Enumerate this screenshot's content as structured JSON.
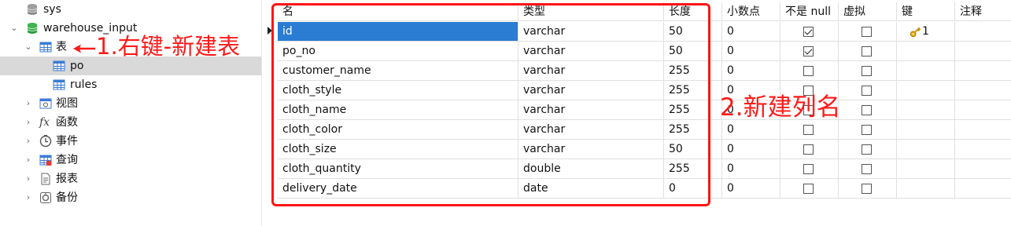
{
  "tree": {
    "items": [
      {
        "label": "sys",
        "icon": "database-icon"
      },
      {
        "label": "warehouse_input",
        "icon": "database-icon"
      },
      {
        "label": "表",
        "icon": "table-folder-icon"
      },
      {
        "label": "po",
        "icon": "table-icon"
      },
      {
        "label": "rules",
        "icon": "table-icon"
      },
      {
        "label": "视图",
        "icon": "view-icon"
      },
      {
        "label": "函数",
        "icon": "function-icon"
      },
      {
        "label": "事件",
        "icon": "event-icon"
      },
      {
        "label": "查询",
        "icon": "query-icon"
      },
      {
        "label": "报表",
        "icon": "report-icon"
      },
      {
        "label": "备份",
        "icon": "backup-icon"
      }
    ],
    "fx_glyph": "fx"
  },
  "annotations": {
    "step1": "1.右键-新建表",
    "step2": "2.新建列名",
    "color": "#ff1a1a"
  },
  "grid": {
    "headers": [
      "名",
      "类型",
      "长度",
      "小数点",
      "不是 null",
      "虚拟",
      "键",
      "注释"
    ],
    "rows": [
      {
        "name": "id",
        "type": "varchar",
        "length": "50",
        "decimal": "0",
        "not_null": true,
        "virtual": false,
        "key": "1"
      },
      {
        "name": "po_no",
        "type": "varchar",
        "length": "50",
        "decimal": "0",
        "not_null": true,
        "virtual": false,
        "key": ""
      },
      {
        "name": "customer_name",
        "type": "varchar",
        "length": "255",
        "decimal": "0",
        "not_null": false,
        "virtual": false,
        "key": ""
      },
      {
        "name": "cloth_style",
        "type": "varchar",
        "length": "255",
        "decimal": "0",
        "not_null": false,
        "virtual": false,
        "key": ""
      },
      {
        "name": "cloth_name",
        "type": "varchar",
        "length": "255",
        "decimal": "0",
        "not_null": false,
        "virtual": false,
        "key": ""
      },
      {
        "name": "cloth_color",
        "type": "varchar",
        "length": "255",
        "decimal": "0",
        "not_null": false,
        "virtual": false,
        "key": ""
      },
      {
        "name": "cloth_size",
        "type": "varchar",
        "length": "50",
        "decimal": "0",
        "not_null": false,
        "virtual": false,
        "key": ""
      },
      {
        "name": "cloth_quantity",
        "type": "double",
        "length": "255",
        "decimal": "0",
        "not_null": false,
        "virtual": false,
        "key": ""
      },
      {
        "name": "delivery_date",
        "type": "date",
        "length": "0",
        "decimal": "0",
        "not_null": false,
        "virtual": false,
        "key": ""
      }
    ],
    "selection_color": "#2b7cd3"
  }
}
